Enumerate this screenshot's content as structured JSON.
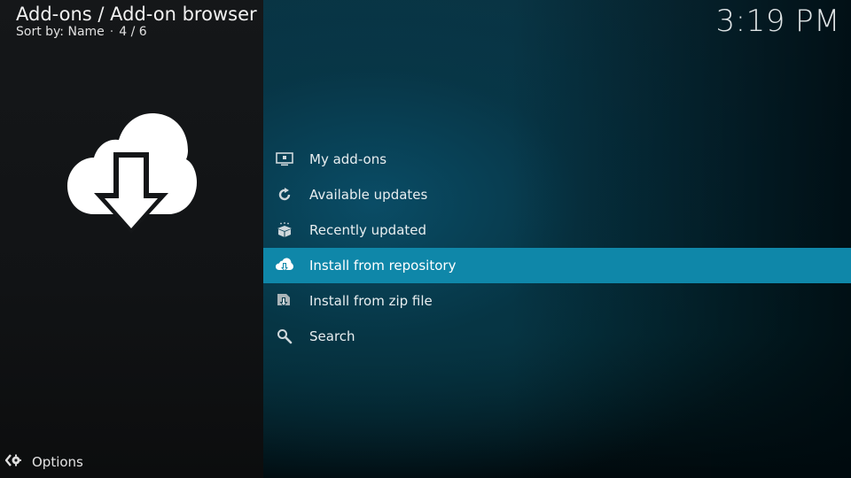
{
  "header": {
    "title": "Add-ons / Add-on browser",
    "sort_label": "Sort by: Name",
    "separator": "·",
    "position": "4 / 6"
  },
  "clock": "3:19 PM",
  "feature_icon": "cloud-download-icon",
  "menu": {
    "items": [
      {
        "label": "My add-ons",
        "icon": "monitor-box-icon",
        "focused": false
      },
      {
        "label": "Available updates",
        "icon": "refresh-icon",
        "focused": false
      },
      {
        "label": "Recently updated",
        "icon": "open-box-icon",
        "focused": false
      },
      {
        "label": "Install from repository",
        "icon": "cloud-download-icon",
        "focused": true
      },
      {
        "label": "Install from zip file",
        "icon": "zip-install-icon",
        "focused": false
      },
      {
        "label": "Search",
        "icon": "search-icon",
        "focused": false
      }
    ]
  },
  "options": {
    "label": "Options",
    "icon": "options-arrows-gear-icon"
  },
  "colors": {
    "focus": "#0f87a9",
    "left_panel": "#131517",
    "background": "#063040"
  }
}
